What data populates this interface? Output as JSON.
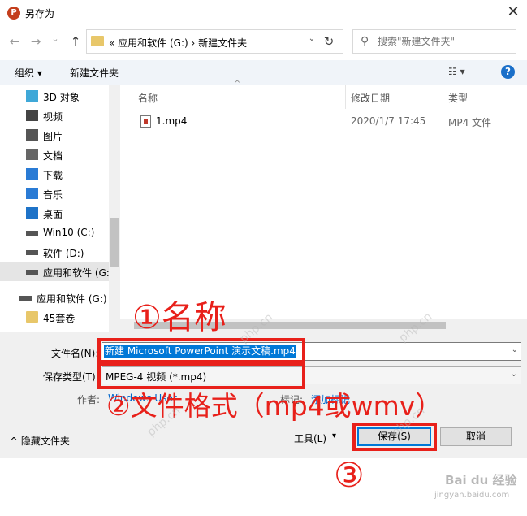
{
  "window": {
    "title": "另存为",
    "app_icon_letter": "P",
    "close_glyph": "✕"
  },
  "nav": {
    "back_glyph": "←",
    "forward_glyph": "→",
    "recent_glyph": "⌄",
    "up_glyph": "↑",
    "address_path": "« 应用和软件 (G:)  ›  新建文件夹",
    "address_dropdown": "⌄",
    "refresh_glyph": "↻",
    "search_placeholder": "搜索\"新建文件夹\"",
    "search_glyph": "⚲"
  },
  "toolbar": {
    "organize": "组织 ▾",
    "new_folder": "新建文件夹",
    "view_glyph": "☷ ▾",
    "help": "?"
  },
  "sidebar": {
    "items": [
      {
        "label": "3D 对象",
        "icon": "cube-icon",
        "color": "#3fa8d8"
      },
      {
        "label": "视频",
        "icon": "film-icon",
        "color": "#444"
      },
      {
        "label": "图片",
        "icon": "picture-icon",
        "color": "#555"
      },
      {
        "label": "文档",
        "icon": "document-icon",
        "color": "#666"
      },
      {
        "label": "下载",
        "icon": "download-icon",
        "color": "#2a7bd5"
      },
      {
        "label": "音乐",
        "icon": "music-icon",
        "color": "#2a7bd5"
      },
      {
        "label": "桌面",
        "icon": "desktop-icon",
        "color": "#1e73c8"
      },
      {
        "label": "Win10 (C:)",
        "icon": "windows-drive-icon",
        "color": "#555"
      },
      {
        "label": "软件 (D:)",
        "icon": "drive-icon",
        "color": "#555"
      },
      {
        "label": "应用和软件 (G:",
        "icon": "drive-icon",
        "color": "#555"
      },
      {
        "label": "应用和软件 (G:)",
        "icon": "drive-icon",
        "color": "#555"
      },
      {
        "label": "45套卷",
        "icon": "folder-icon",
        "color": "#e8c76a"
      }
    ]
  },
  "filelist": {
    "columns": {
      "name": "名称",
      "modified": "修改日期",
      "type": "类型",
      "sort_caret": "^"
    },
    "rows": [
      {
        "name": "1.mp4",
        "modified": "2020/1/7 17:45",
        "type": "MP4 文件"
      }
    ]
  },
  "form": {
    "filename_label": "文件名(N):",
    "filename_value": "新建 Microsoft PowerPoint 演示文稿.mp4",
    "filetype_label": "保存类型(T):",
    "filetype_value": "MPEG-4 视频 (*.mp4)",
    "author_label": "作者:",
    "author_value": "Windows User",
    "tags_label": "标记:",
    "tags_value": "添加标记",
    "dropdown_glyph": "⌄"
  },
  "footer": {
    "hide_folders": "^ 隐藏文件夹",
    "tools": "工具(L)",
    "tools_caret": "▾",
    "save": "保存(S)",
    "cancel": "取消"
  },
  "annotations": {
    "name": "①名称",
    "format": "②文件格式（mp4或wmv）",
    "save": "③"
  },
  "watermarks": {
    "php": "php.cn",
    "baidu": "Bai du 经验",
    "baidu_url": "jingyan.baidu.com"
  }
}
